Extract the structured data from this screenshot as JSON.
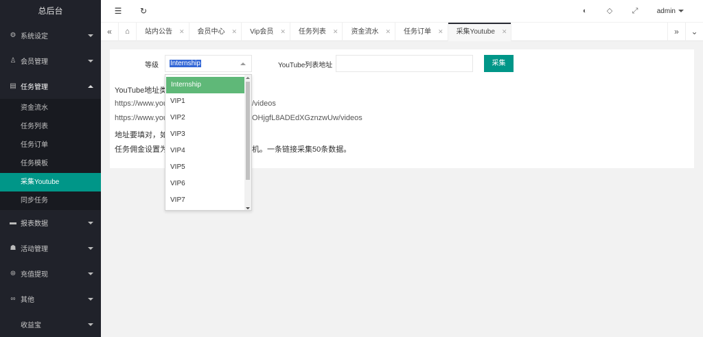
{
  "sidebar": {
    "title": "总后台",
    "groups": [
      {
        "label": "系统设定",
        "icon": "gear-icon"
      },
      {
        "label": "会员管理",
        "icon": "user-icon"
      },
      {
        "label": "任务管理",
        "icon": "document-icon"
      },
      {
        "label": "报表数据",
        "icon": "chart-icon"
      },
      {
        "label": "活动管理",
        "icon": "group-icon"
      },
      {
        "label": "充值提现",
        "icon": "money-icon"
      },
      {
        "label": "其他",
        "icon": "link-icon"
      },
      {
        "label": "收益宝",
        "icon": ""
      }
    ],
    "task_items": [
      "资金流水",
      "任务列表",
      "任务订单",
      "任务模板",
      "采集Youtube",
      "同步任务"
    ]
  },
  "header": {
    "user": "admin"
  },
  "tabs": [
    "站内公告",
    "会员中心",
    "Vip会员",
    "任务列表",
    "资金流水",
    "任务订单",
    "采集Youtube"
  ],
  "form": {
    "grade_label": "等级",
    "grade_value": "Internship",
    "yt_label": "YouTube列表地址",
    "yt_value": "",
    "collect_button": "采集"
  },
  "dropdown_options": [
    "Internship",
    "VIP1",
    "VIP2",
    "VIP3",
    "VIP4",
    "VIP5",
    "VIP6",
    "VIP7"
  ],
  "info": {
    "line1": "YouTube地址类",
    "line2_a": "https://www.you",
    "line2_b": "/videos",
    "line3_a": "https://www.you",
    "line3_b": "OHjgfL8ADEdXGznzwUw/videos",
    "line4": "地址要填对，如",
    "line5_a": "任务佣金设置为",
    "line5_b": "机。一条链接采集50条数据。"
  }
}
